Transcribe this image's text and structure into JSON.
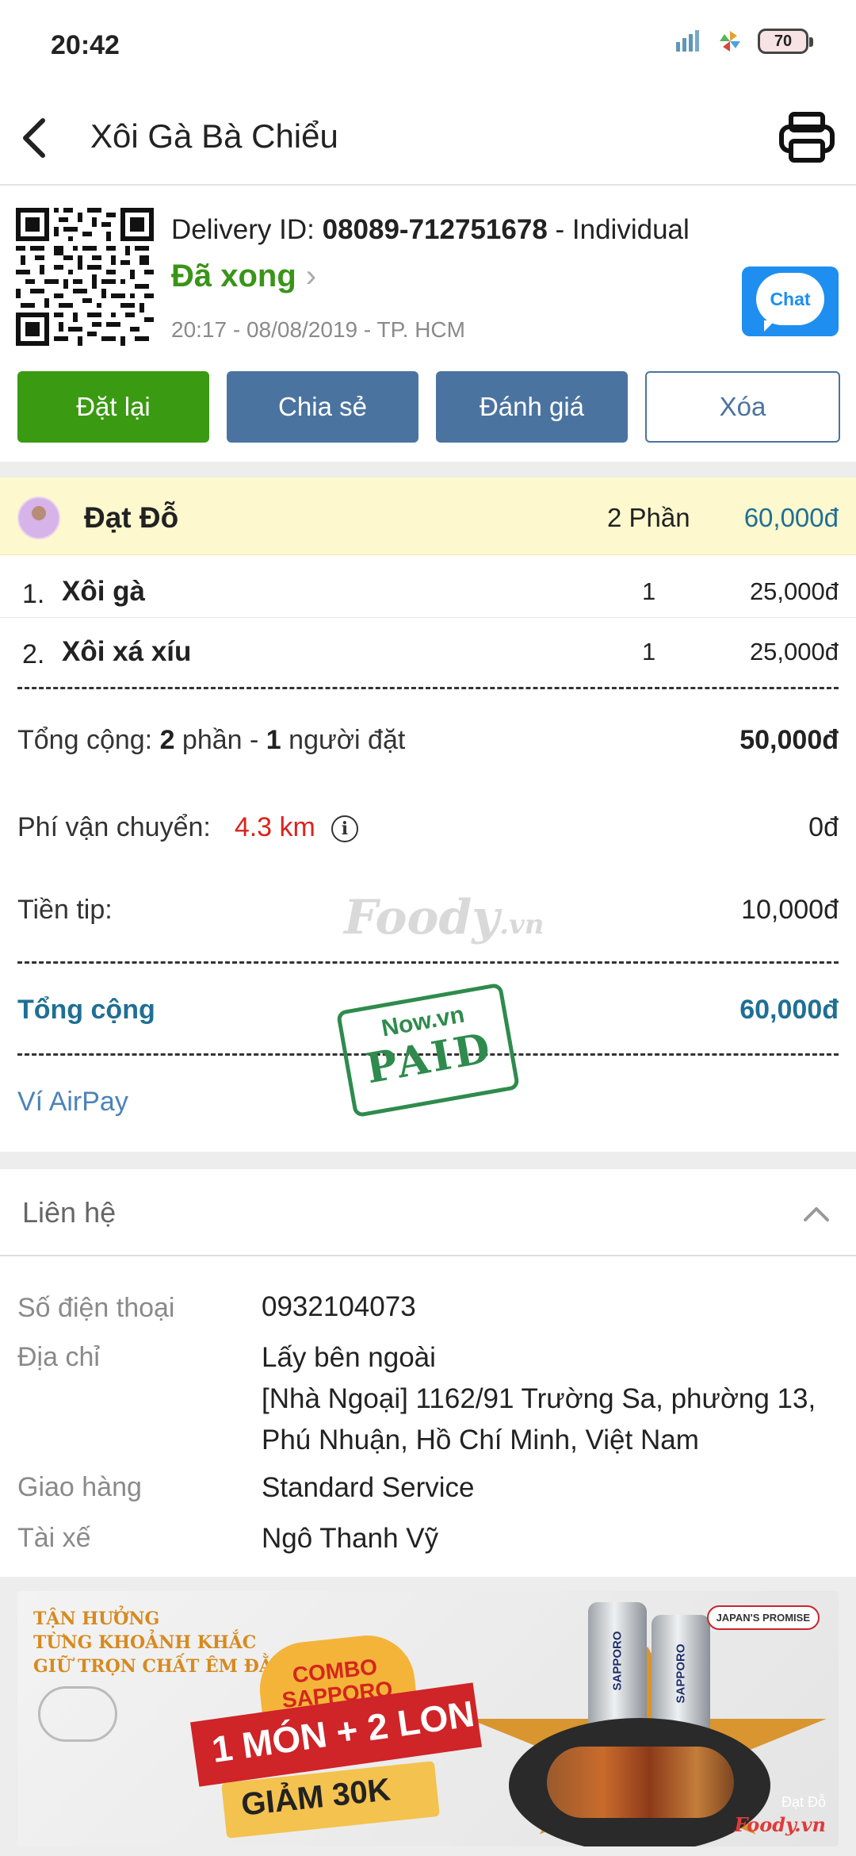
{
  "status_bar": {
    "time": "20:42",
    "battery": "70"
  },
  "header": {
    "title": "Xôi Gà Bà Chiểu"
  },
  "order": {
    "delivery_label": "Delivery ID:",
    "delivery_id": "08089-712751678",
    "delivery_type": "- Individual",
    "status": "Đã xong",
    "time_place": "20:17 - 08/08/2019 - TP. HCM",
    "chat_label": "Chat"
  },
  "actions": [
    {
      "label": "Đặt lại",
      "style": "green"
    },
    {
      "label": "Chia sẻ",
      "style": "blue"
    },
    {
      "label": "Đánh giá",
      "style": "blue"
    },
    {
      "label": "Xóa",
      "style": "outline"
    }
  ],
  "orderer": {
    "name": "Đạt Đỗ",
    "portions": "2 Phần",
    "total": "60,000đ"
  },
  "items": [
    {
      "index": "1.",
      "name": "Xôi gà",
      "qty": "1",
      "price": "25,000đ"
    },
    {
      "index": "2.",
      "name": "Xôi xá xíu",
      "qty": "1",
      "price": "25,000đ"
    }
  ],
  "summary": {
    "subtotal_prefix": "Tổng cộng: ",
    "subtotal_portions": "2",
    "subtotal_mid": " phần - ",
    "subtotal_people": "1",
    "subtotal_suffix": " người đặt",
    "subtotal_value": "50,000đ",
    "shipping_label": "Phí vận chuyển:",
    "shipping_distance": "4.3 km",
    "shipping_value": "0đ",
    "tip_label": "Tiền tip:",
    "tip_value": "10,000đ",
    "total_label": "Tổng cộng",
    "total_value": "60,000đ",
    "payment_method": "Ví AirPay"
  },
  "watermark": {
    "text": "Foody",
    "suffix": ".vn"
  },
  "stamp": {
    "brand": "Now.vn",
    "text": "PAID"
  },
  "contact": {
    "title": "Liên hệ",
    "rows": [
      {
        "label": "Số điện thoại",
        "value": "0932104073"
      },
      {
        "label": "Địa chỉ",
        "value": "Lấy bên ngoài",
        "value2": "[Nhà Ngoại] 1162/91 Trường Sa, phường 13, Phú Nhuận, Hồ Chí Minh, Việt Nam"
      },
      {
        "label": "Giao hàng",
        "value": "Standard Service"
      },
      {
        "label": "Tài xế",
        "value": "Ngô Thanh Vỹ"
      }
    ]
  },
  "banner": {
    "tagline_1": "TẬN HƯỞNG",
    "tagline_2": "TỪNG KHOẢNH KHẮC",
    "tagline_3": "GIỮ TRỌN CHẤT ÊM ĐẰM",
    "combo_1": "COMBO",
    "combo_2": "SAPPORO",
    "main": "1 MÓN + 2 LON",
    "sale": "GIẢM 30K",
    "brand": "JAPAN'S PROMISE",
    "can_label": "SAPPORO",
    "owner": "Đạt Đỗ",
    "foody": "Foody.vn"
  }
}
